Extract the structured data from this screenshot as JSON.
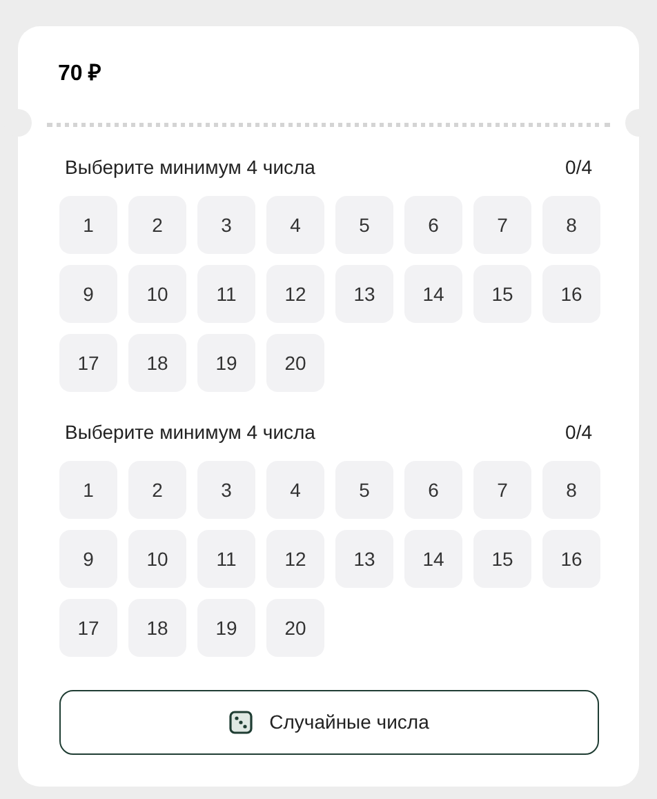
{
  "price": "70 ₽",
  "fields": [
    {
      "title": "Выберите минимум 4 числа",
      "counter": "0/4",
      "numbers": [
        {
          "label": "1",
          "selected": false
        },
        {
          "label": "2",
          "selected": false
        },
        {
          "label": "3",
          "selected": false
        },
        {
          "label": "4",
          "selected": false
        },
        {
          "label": "5",
          "selected": false
        },
        {
          "label": "6",
          "selected": false
        },
        {
          "label": "7",
          "selected": false
        },
        {
          "label": "8",
          "selected": false
        },
        {
          "label": "9",
          "selected": false
        },
        {
          "label": "10",
          "selected": false
        },
        {
          "label": "11",
          "selected": false
        },
        {
          "label": "12",
          "selected": false
        },
        {
          "label": "13",
          "selected": false
        },
        {
          "label": "14",
          "selected": false
        },
        {
          "label": "15",
          "selected": false
        },
        {
          "label": "16",
          "selected": false
        },
        {
          "label": "17",
          "selected": false
        },
        {
          "label": "18",
          "selected": false
        },
        {
          "label": "19",
          "selected": false
        },
        {
          "label": "20",
          "selected": false
        }
      ]
    },
    {
      "title": "Выберите минимум 4 числа",
      "counter": "0/4",
      "numbers": [
        {
          "label": "1",
          "selected": false
        },
        {
          "label": "2",
          "selected": false
        },
        {
          "label": "3",
          "selected": false
        },
        {
          "label": "4",
          "selected": false
        },
        {
          "label": "5",
          "selected": false
        },
        {
          "label": "6",
          "selected": false
        },
        {
          "label": "7",
          "selected": false
        },
        {
          "label": "8",
          "selected": false
        },
        {
          "label": "9",
          "selected": false
        },
        {
          "label": "10",
          "selected": false
        },
        {
          "label": "11",
          "selected": false
        },
        {
          "label": "12",
          "selected": false
        },
        {
          "label": "13",
          "selected": false
        },
        {
          "label": "14",
          "selected": false
        },
        {
          "label": "15",
          "selected": false
        },
        {
          "label": "16",
          "selected": false
        },
        {
          "label": "17",
          "selected": false
        },
        {
          "label": "18",
          "selected": false
        },
        {
          "label": "19",
          "selected": false
        },
        {
          "label": "20",
          "selected": false
        }
      ]
    }
  ],
  "random_button": "Случайные числа"
}
